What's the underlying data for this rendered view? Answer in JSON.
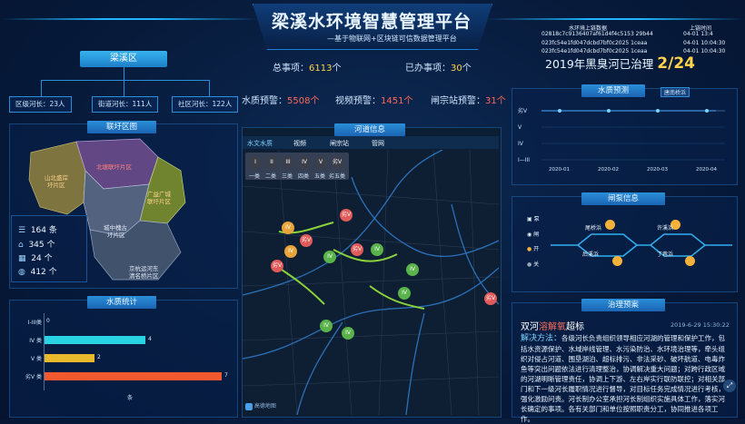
{
  "header": {
    "title": "梁溪水环境智慧管理平台",
    "subtitle": "—基于物联网+区块链可信数据管理平台"
  },
  "district": {
    "name": "梁溪区",
    "leaders": [
      {
        "label": "区级河长：23人"
      },
      {
        "label": "街道河长：111人"
      },
      {
        "label": "社区河长：122人"
      }
    ]
  },
  "stats": {
    "total_label": "总事项：",
    "total_value": "6113",
    "total_unit": "个",
    "done_label": "已办事项：",
    "done_value": "30",
    "done_unit": "个",
    "water_alert_label": "水质预警：",
    "water_alert_value": "5508",
    "water_alert_unit": "个",
    "video_alert_label": "视频预警：",
    "video_alert_value": "1451",
    "video_alert_unit": "个",
    "gate_alert_label": "闸宗站预警：",
    "gate_alert_value": "31",
    "gate_alert_unit": "个"
  },
  "blockchain": {
    "col1": "水环境上链数据",
    "col2": "上链时间",
    "rows": [
      {
        "hash": "02818c7c9136407af61d4f4c5153 29b44",
        "time": "04-01 13:4"
      },
      {
        "hash": "023fc54e1fd047dcbd7bf0c2025 1ceaa",
        "time": "04-01 10:04:30"
      },
      {
        "hash": "023fc54e1fd047dcbd7bf0c2025 1ceaa",
        "time": "04-01 10:04:30"
      }
    ]
  },
  "black_river": {
    "label": "2019年黑臭河已治理",
    "value": "2/24"
  },
  "region_map": {
    "title": "联圩区图",
    "areas": [
      {
        "name": "山北盛岸\n圩片区"
      },
      {
        "name": "北塘联圩片区"
      },
      {
        "name": "广益广城\n联圩片区"
      },
      {
        "name": "城中槐古\n圩片区"
      },
      {
        "name": "京杭运河东\n清名桥片区"
      }
    ],
    "legend": [
      {
        "icon": "list-icon",
        "value": "164",
        "unit": "条"
      },
      {
        "icon": "home-icon",
        "value": "345",
        "unit": "个"
      },
      {
        "icon": "calendar-icon",
        "value": "24",
        "unit": "个"
      },
      {
        "icon": "globe-icon",
        "value": "412",
        "unit": "个"
      }
    ]
  },
  "water_stats": {
    "title": "水质统计",
    "rows": [
      {
        "label": "I-III类",
        "value": 0,
        "color": "#2fd4e6"
      },
      {
        "label": "IV 类",
        "value": 4,
        "color": "#29d3e3"
      },
      {
        "label": "V 类",
        "value": 2,
        "color": "#e7b92b"
      },
      {
        "label": "劣V 类",
        "value": 7,
        "color": "#f2592e"
      }
    ],
    "axis_unit": "条",
    "x_max": 7
  },
  "river_info": {
    "title": "河道信息",
    "tabs": [
      {
        "label": "水文水质"
      },
      {
        "label": "视频"
      },
      {
        "label": "闸宗站"
      },
      {
        "label": "管网"
      }
    ],
    "classes": [
      {
        "code": "I",
        "name": "一类"
      },
      {
        "code": "II",
        "name": "二类"
      },
      {
        "code": "III",
        "name": "三类"
      },
      {
        "code": "IV",
        "name": "四类"
      },
      {
        "code": "V",
        "name": "五类"
      },
      {
        "code": "劣V",
        "name": "劣五类"
      }
    ],
    "map_credit": "高德地图"
  },
  "wq_forecast": {
    "title": "水质预测",
    "tag": "唐南桥浜",
    "y_labels": [
      "劣V",
      "V",
      "IV",
      "I—III"
    ],
    "x_labels": [
      "2020-01",
      "2020-02",
      "2020-03",
      "2020-04"
    ]
  },
  "gate_info": {
    "title": "闸泵信息",
    "legend": [
      {
        "label": "泵",
        "color": "#d9e6f5"
      },
      {
        "label": "闸",
        "color": "#d9e6f5"
      },
      {
        "label": "开",
        "color": "#f5b23a"
      },
      {
        "label": "关",
        "color": "#9aa7b7"
      }
    ],
    "stations": [
      {
        "name": "尾桥浜"
      },
      {
        "name": "许溪浜"
      },
      {
        "name": "后溪浜"
      },
      {
        "name": "丁巷浜"
      }
    ]
  },
  "alert": {
    "title": "治理预案",
    "river": "双河",
    "level": "溶解氧",
    "status": "超标",
    "time": "2019-6-29 15:30:22",
    "method_label": "解决方法：",
    "method_text": "各级河长负责组织领导相应河湖的管理和保护工作，包括水资源保护、水域岸线管理、水污染防治、水环境治理等，牵头组织对侵占河道、围垦湖泊、超标排污、非法采砂、破坏航道、电毒炸鱼等突出问题依法进行清理整治，协调解决重大问题；对跨行政区域的河湖明晰管理责任，协调上下游、左右岸实行联防联控；对相关部门和下一级河长履职情况进行督导，对目标任务完成情况进行考核，强化激励问责。河长制办公室承担河长制组织实施具体工作，落实河长确定的事项。各有关部门和单位按照职责分工，协同推进各项工作。"
  }
}
